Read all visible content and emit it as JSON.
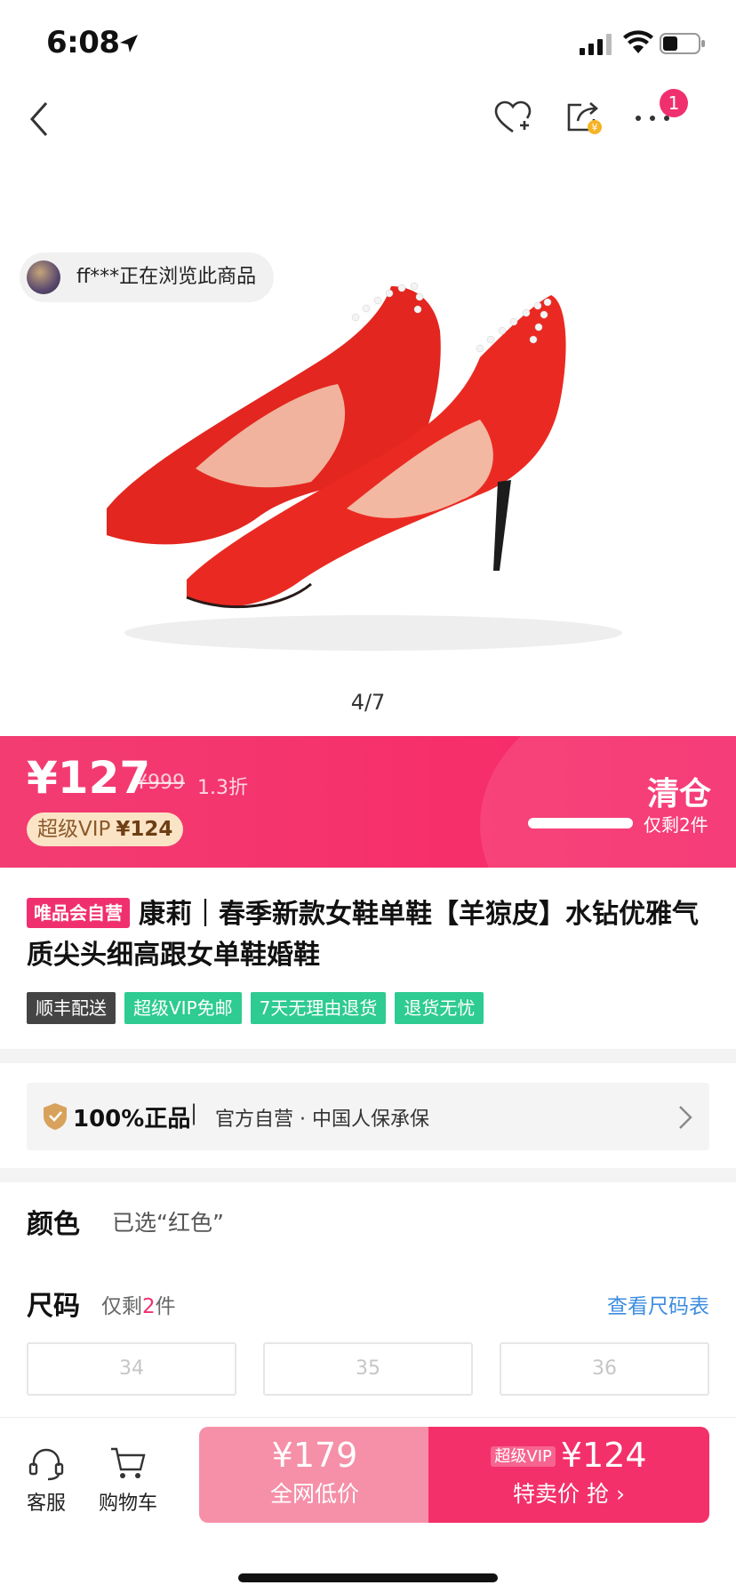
{
  "status_bar": {
    "time": "6:08"
  },
  "nav": {
    "more_badge": "1"
  },
  "gallery": {
    "browsing_text": "ff***正在浏览此商品",
    "page_indicator": "4/7"
  },
  "price": {
    "current": "¥127",
    "original": "¥999",
    "discount": "1.3折",
    "vip_label": "超级VIP",
    "vip_price": "¥124",
    "clearance_label": "清仓",
    "stock_text": "仅剩2件",
    "stock_level": 0.9
  },
  "product": {
    "self_operated_tag": "唯品会自营",
    "title": "康莉｜春季新款女鞋单鞋【羊猄皮】水钻优雅气质尖头细高跟女单鞋婚鞋",
    "service_tags": [
      "顺丰配送",
      "超级VIP免邮",
      "7天无理由退货",
      "退货无忧"
    ]
  },
  "guarantee": {
    "strong": "100%正品",
    "separator": "|",
    "text": "官方自营 · 中国人保承保"
  },
  "color_option": {
    "label": "颜色",
    "value": "已选“红色”"
  },
  "size_option": {
    "label": "尺码",
    "note_prefix": "仅剩",
    "note_num": "2",
    "note_suffix": "件",
    "chart_link": "查看尺码表",
    "sizes": [
      "34",
      "35",
      "36"
    ]
  },
  "bottom_bar": {
    "service_label": "客服",
    "cart_label": "购物车",
    "low_price": "¥179",
    "low_label": "全网低价",
    "vip_mini": "超级VIP",
    "buy_price": "¥124",
    "buy_label": "特卖价 抢 ›"
  },
  "colors": {
    "brand_pink": "#f3306a",
    "light_pink": "#f590a8",
    "green_tag": "#2ecb92",
    "link_blue": "#3d8de0"
  }
}
